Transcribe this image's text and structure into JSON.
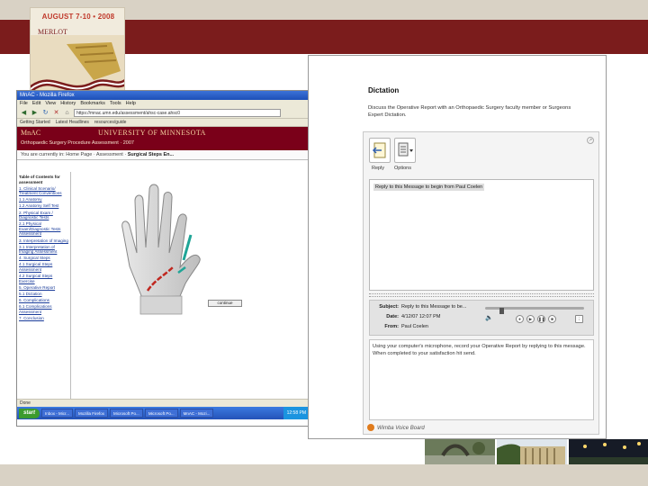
{
  "slide": {
    "conference_dates": "AUGUST 7-10 • 2008",
    "conference_brand": "MERLOT",
    "colors": {
      "maroon": "#7b1c1c",
      "tan": "#d9d2c5"
    }
  },
  "browser": {
    "window_title": "MnAC - Mozilla Firefox",
    "menu": [
      "File",
      "Edit",
      "View",
      "History",
      "Bookmarks",
      "Tools",
      "Help"
    ],
    "url": "https://mnac.umn.edu/assessment/ahsc-case.ahsc0",
    "bookmarks": [
      "Getting Started",
      "Latest Headlines",
      "resources/guide"
    ],
    "site_title_left": "MnAC",
    "site_title_right": "UNIVERSITY OF MINNESOTA",
    "page_subtitle": "Orthopaedic Surgery Procedure Assessment · 2007",
    "breadcrumb_prefix": "You are currently in: Home Page · Assessment ·",
    "breadcrumb_current": "Surgical Steps En...",
    "toc": [
      {
        "label": "Table of Contents for assessment",
        "bold": true
      },
      {
        "label": "1. Clinical Scenario/ Treatment Conventions",
        "bold": false
      },
      {
        "label": "1.1 Anatomy",
        "bold": false
      },
      {
        "label": "1.2 Anatomy Self Test",
        "bold": false
      },
      {
        "label": "2. Physical Exam / Diagnostic Tests",
        "bold": false
      },
      {
        "label": "2.1 Physical Exam/Diagnostic Tests Assessment",
        "bold": false
      },
      {
        "label": "3. Interpretation of Imaging",
        "bold": false
      },
      {
        "label": "3.1 Interpretation of Imaging Assessment",
        "bold": false
      },
      {
        "label": "4. Surgical Steps",
        "bold": false
      },
      {
        "label": "4.1 Surgical Steps Assessment",
        "bold": false
      },
      {
        "label": "4.2 Surgical Steps Exercise",
        "bold": false
      },
      {
        "label": "5. Operative Report",
        "bold": false
      },
      {
        "label": "5.1 Dictation",
        "bold": false
      },
      {
        "label": "6. Complications",
        "bold": false
      },
      {
        "label": "6.1 Complications Assessment",
        "bold": false
      },
      {
        "label": "7. Conclusion",
        "bold": false
      }
    ],
    "continue_label": "continue",
    "status": "Done",
    "taskbar": {
      "start": "start",
      "items": [
        "Inbox - Micr...",
        "Mozilla Firefox",
        "Microsoft Po...",
        "Microsoft Po...",
        "MnAC - Mozi..."
      ],
      "clock": "12:58 PM"
    }
  },
  "dictation": {
    "heading": "Dictation",
    "instructions": "Discuss the Operative Report with an Orthopaedic Surgery faculty member or Surgeons Expert Dictation.",
    "toolbar": {
      "reply": "Reply",
      "options": "Options"
    },
    "messages": [
      "Reply to this Message to begin from Paul Coelen"
    ],
    "detail": {
      "subject_label": "Subject:",
      "subject": "Reply to this Message to be...",
      "date_label": "Date:",
      "date": "4/12/07 12:07 PM",
      "from_label": "From:",
      "from": "Paul Coelen"
    },
    "message_body": "Using your computer's microphone, record your Operative Report by replying to this message. When completed to your satisfaction hit send.",
    "playback_position": 0.15,
    "brand": "Wimba Voice Board"
  }
}
